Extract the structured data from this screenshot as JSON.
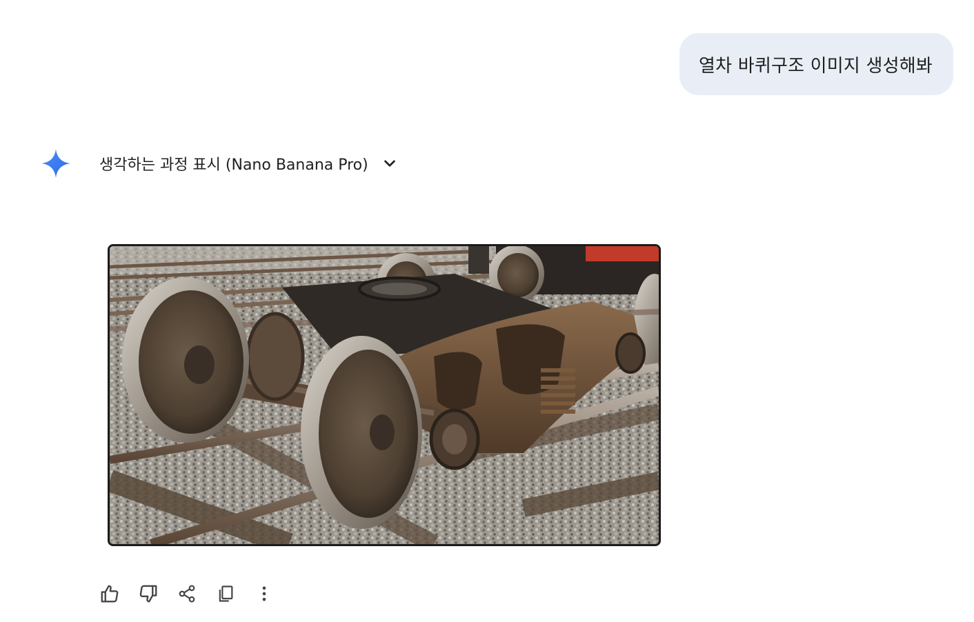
{
  "user_message": {
    "text": "열차 바퀴구조 이미지 생성해봐"
  },
  "response": {
    "thinking_label": "생각하는 과정 표시 (Nano Banana Pro)",
    "image": {
      "subject": "train-wheel-bogie"
    }
  },
  "actions": [
    {
      "icon": "thumbs-up-icon"
    },
    {
      "icon": "thumbs-down-icon"
    },
    {
      "icon": "share-icon"
    },
    {
      "icon": "copy-icon"
    },
    {
      "icon": "more-vert-icon"
    }
  ],
  "colors": {
    "bubble_bg": "#e9eef6",
    "text": "#1f1f1f",
    "gemini_blue": "#4285f4",
    "icon_gray": "#444746"
  }
}
